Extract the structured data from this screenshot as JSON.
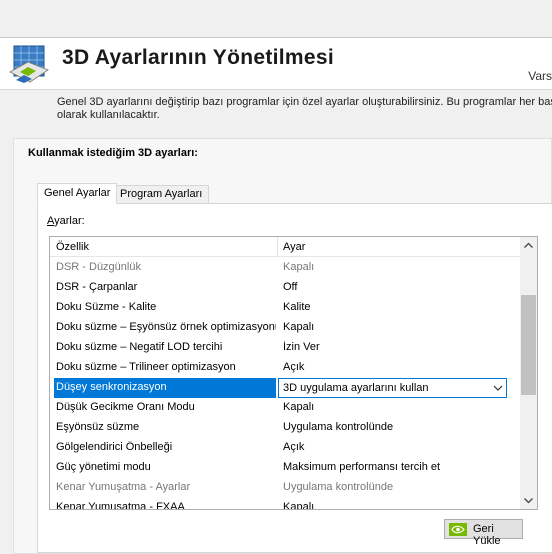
{
  "header": {
    "title": "3D Ayarlarının Yönetilmesi",
    "right_text": "Vars"
  },
  "description": {
    "line1": "Genel 3D ayarlarını değiştirip bazı programlar için özel ayarlar oluşturabilirsiniz. Bu programlar her başlatılınc",
    "line2": "olarak kullanılacaktır."
  },
  "panel": {
    "heading": "Kullanmak istediğim 3D ayarları:",
    "tabs": [
      {
        "label": "Genel Ayarlar",
        "active": true
      },
      {
        "label": "Program Ayarları",
        "active": false
      }
    ],
    "settings_label_accesskey": "A",
    "settings_label_rest": "yarlar:"
  },
  "grid": {
    "columns": [
      "Özellik",
      "Ayar"
    ],
    "rows": [
      {
        "name": "DSR - Düzgünlük",
        "value": "Kapalı",
        "dim": true
      },
      {
        "name": "DSR - Çarpanlar",
        "value": "Off",
        "dim": false
      },
      {
        "name": "Doku Süzme - Kalite",
        "value": "Kalite",
        "dim": false
      },
      {
        "name": "Doku süzme – Eşyönsüz örnek optimizasyonu",
        "value": "Kapalı",
        "dim": false
      },
      {
        "name": "Doku süzme – Negatif LOD tercihi",
        "value": "İzin Ver",
        "dim": false
      },
      {
        "name": "Doku süzme – Trilineer optimizasyon",
        "value": "Açık",
        "dim": false
      },
      {
        "name": "Düşey senkronizasyon",
        "value": "3D uygulama ayarlarını kullan",
        "selected": true
      },
      {
        "name": "Düşük Gecikme Oranı Modu",
        "value": "Kapalı",
        "dim": false
      },
      {
        "name": "Eşyönsüz süzme",
        "value": "Uygulama kontrolünde",
        "dim": false
      },
      {
        "name": "Gölgelendirici Önbelleği",
        "value": "Açık",
        "dim": false
      },
      {
        "name": "Güç yönetimi modu",
        "value": "Maksimum performansı tercih et",
        "dim": false
      },
      {
        "name": "Kenar Yumuşatma - Ayarlar",
        "value": "Uygulama kontrolünde",
        "dim": true
      },
      {
        "name": "Kenar Yumuşatma - FXAA",
        "value": "Kapalı",
        "dim": false
      }
    ],
    "scroll_position": 0.35
  },
  "restore_button": {
    "label": "Geri Yükle"
  },
  "colors": {
    "selection": "#0078d7",
    "nvidia_green": "#76b900"
  },
  "icons": [
    "nvidia-3d-settings-icon",
    "chevron-up-icon",
    "chevron-down-icon",
    "nvidia-logo-icon"
  ]
}
